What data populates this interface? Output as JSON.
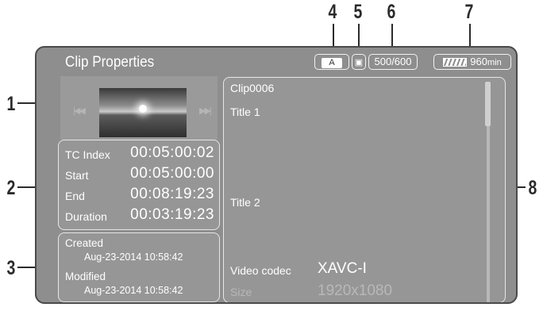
{
  "callouts": {
    "n1": "1",
    "n2": "2",
    "n3": "3",
    "n4": "4",
    "n5": "5",
    "n6": "6",
    "n7": "7",
    "n8": "8"
  },
  "screen": {
    "title": "Clip Properties",
    "media_slot": "A",
    "lock_icon": "lock-icon",
    "clip_count": "500/600",
    "battery_remaining": "960",
    "battery_unit": "min"
  },
  "thumbnail": {
    "prev_icon": "skip-previous-icon",
    "next_icon": "skip-next-icon"
  },
  "timecode": {
    "rows": [
      {
        "label": "TC Index",
        "value": "00:05:00:02"
      },
      {
        "label": "Start",
        "value": "00:05:00:00"
      },
      {
        "label": "End",
        "value": "00:08:19:23"
      },
      {
        "label": "Duration",
        "value": "00:03:19:23"
      }
    ]
  },
  "dates": {
    "created_label": "Created",
    "created_value": "Aug-23-2014 10:58:42",
    "modified_label": "Modified",
    "modified_value": "Aug-23-2014 10:58:42"
  },
  "details": {
    "clip_name": "Clip0006",
    "title1": "Title 1",
    "title2": "Title 2",
    "video_codec_label": "Video codec",
    "video_codec_value": "XAVC-I",
    "size_label": "Size",
    "size_value": "1920x1080"
  }
}
